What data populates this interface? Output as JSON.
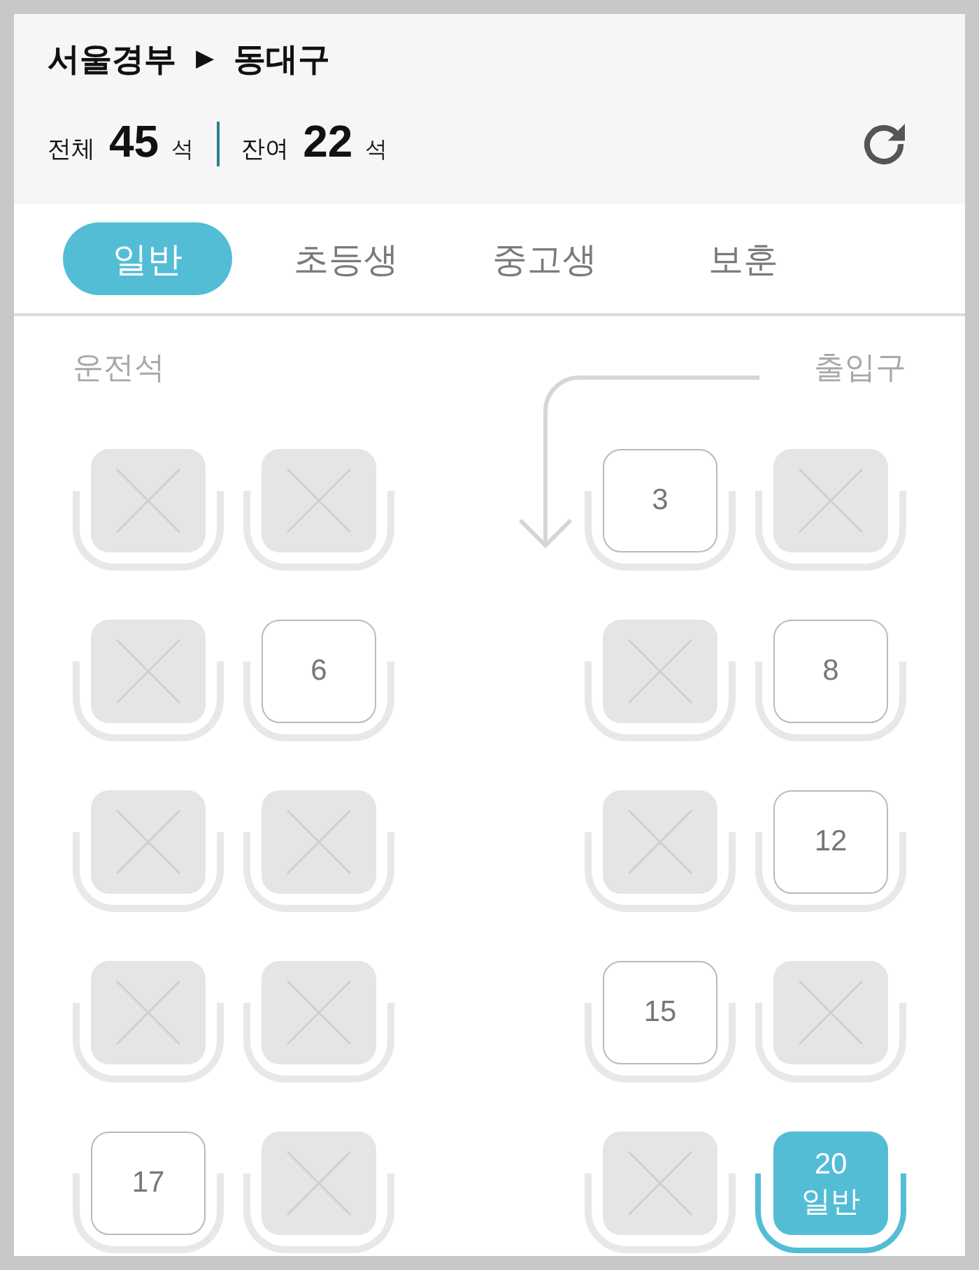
{
  "header": {
    "route": {
      "origin": "서울경부",
      "arrow": "▶",
      "destination": "동대구"
    },
    "stats": [
      {
        "label": "전체",
        "count": "45",
        "unit": "석"
      },
      {
        "label": "잔여",
        "count": "22",
        "unit": "석"
      }
    ]
  },
  "tabs": [
    {
      "label": "일반",
      "selected": true
    },
    {
      "label": "초등생",
      "selected": false
    },
    {
      "label": "중고생",
      "selected": false
    },
    {
      "label": "보훈",
      "selected": false
    }
  ],
  "seat_map": {
    "driver_label": "운전석",
    "entrance_label": "출입구",
    "rows": [
      {
        "left": [
          {
            "kind": "taken",
            "selected": false
          },
          {
            "kind": "taken",
            "selected": false
          }
        ],
        "right": [
          {
            "kind": "open",
            "number": "3",
            "selected": false
          },
          {
            "kind": "taken",
            "selected": false
          }
        ]
      },
      {
        "left": [
          {
            "kind": "taken",
            "selected": false
          },
          {
            "kind": "open",
            "number": "6",
            "selected": false
          }
        ],
        "right": [
          {
            "kind": "taken",
            "selected": false
          },
          {
            "kind": "open",
            "number": "8",
            "selected": false
          }
        ]
      },
      {
        "left": [
          {
            "kind": "taken",
            "selected": false
          },
          {
            "kind": "taken",
            "selected": false
          }
        ],
        "right": [
          {
            "kind": "taken",
            "selected": false
          },
          {
            "kind": "open",
            "number": "12",
            "selected": false
          }
        ]
      },
      {
        "left": [
          {
            "kind": "taken",
            "selected": false
          },
          {
            "kind": "taken",
            "selected": false
          }
        ],
        "right": [
          {
            "kind": "open",
            "number": "15",
            "selected": false
          },
          {
            "kind": "taken",
            "selected": false
          }
        ]
      },
      {
        "left": [
          {
            "kind": "open",
            "number": "17",
            "selected": false
          },
          {
            "kind": "taken",
            "selected": false
          }
        ],
        "right": [
          {
            "kind": "taken",
            "selected": false
          },
          {
            "kind": "open",
            "number": "20",
            "label": "일반",
            "selected": true
          }
        ]
      }
    ]
  }
}
